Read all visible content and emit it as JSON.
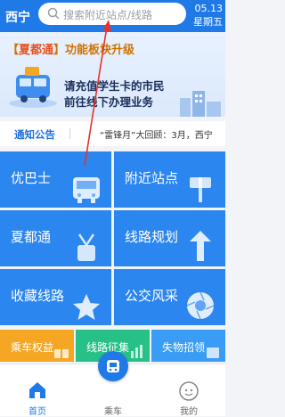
{
  "header": {
    "city": "西宁",
    "search_placeholder": "搜索附近站点/线路",
    "date": "05.13",
    "weekday": "星期五"
  },
  "banner": {
    "tag_open": "【",
    "tag_highlight": "夏都通",
    "tag_close": "】功能板块升级",
    "line1": "请充值学生卡的市民",
    "line2": "前往线下办理业务"
  },
  "notice": {
    "title": "通知公告",
    "text": "“雷锋月”大回顾：3月，西宁"
  },
  "tiles": [
    {
      "label": "优巴士",
      "icon": "bus-icon"
    },
    {
      "label": "附近站点",
      "icon": "bus-stop-icon"
    },
    {
      "label": "夏都通",
      "icon": "lanyard-card-icon"
    },
    {
      "label": "线路规划",
      "icon": "route-arrow-icon"
    },
    {
      "label": "收藏线路",
      "icon": "star-icon"
    },
    {
      "label": "公交风采",
      "icon": "camera-shutter-icon"
    }
  ],
  "quick": [
    {
      "label": "乘车权益",
      "color": "#f5a623"
    },
    {
      "label": "线路征集",
      "color": "#27c087"
    },
    {
      "label": "失物招领",
      "color": "#3a9cf5"
    }
  ],
  "tabbar": {
    "home": "首页",
    "ride": "乘车",
    "mine": "我的"
  },
  "colors": {
    "primary": "#1f7ae8",
    "tile": "#2c86f0",
    "annotation_arrow": "#e8302c"
  }
}
